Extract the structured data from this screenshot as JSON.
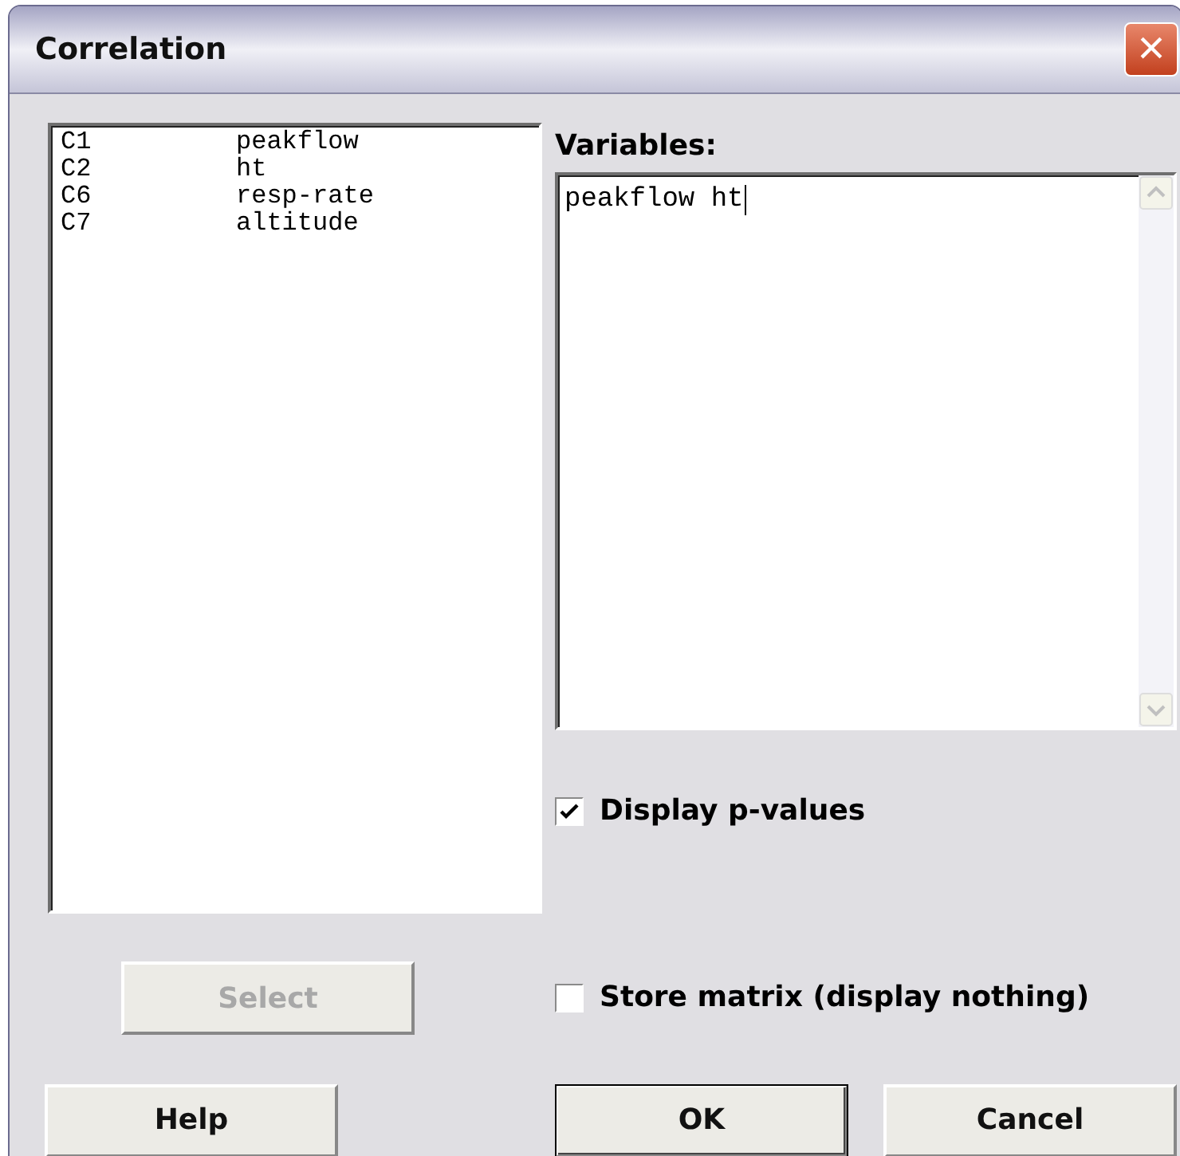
{
  "window": {
    "title": "Correlation",
    "close": "×"
  },
  "columns_list": [
    {
      "id": "C1",
      "name": "peakflow"
    },
    {
      "id": "C2",
      "name": "ht"
    },
    {
      "id": "C6",
      "name": "resp-rate"
    },
    {
      "id": "C7",
      "name": "altitude"
    }
  ],
  "variables": {
    "label": "Variables:",
    "value": "peakflow ht"
  },
  "options": [
    {
      "label": "Display p-values",
      "checked": true
    },
    {
      "label": "Store matrix (display nothing)",
      "checked": false
    }
  ],
  "select_button": {
    "label": "Select",
    "disabled": true
  },
  "buttons": [
    {
      "label": "Help",
      "default": false
    },
    {
      "label": "OK",
      "default": true
    },
    {
      "label": "Cancel",
      "default": false
    }
  ]
}
